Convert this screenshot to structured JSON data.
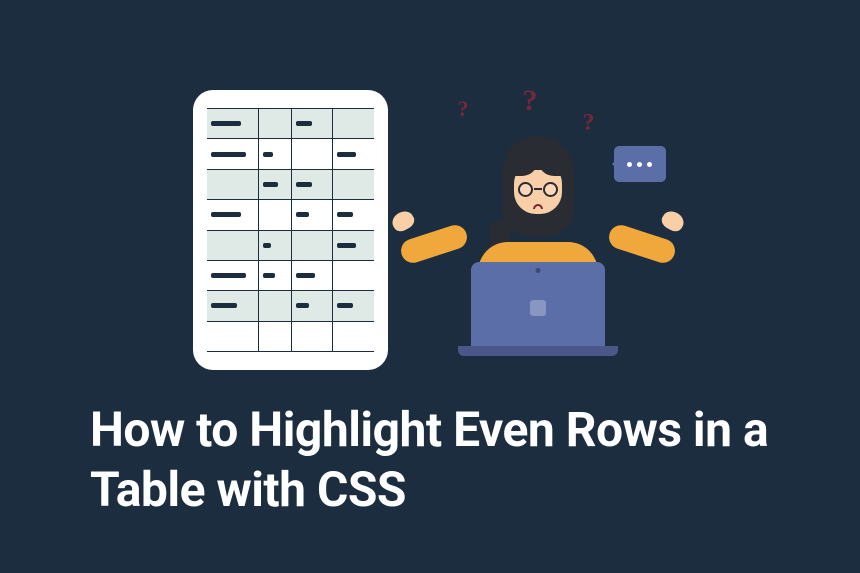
{
  "title": "How to Highlight Even Rows in a Table with CSS",
  "table_illustration": {
    "rows": 8,
    "cols": 4
  },
  "question_marks": [
    "?",
    "?",
    "?"
  ],
  "speech_bubble": "..."
}
